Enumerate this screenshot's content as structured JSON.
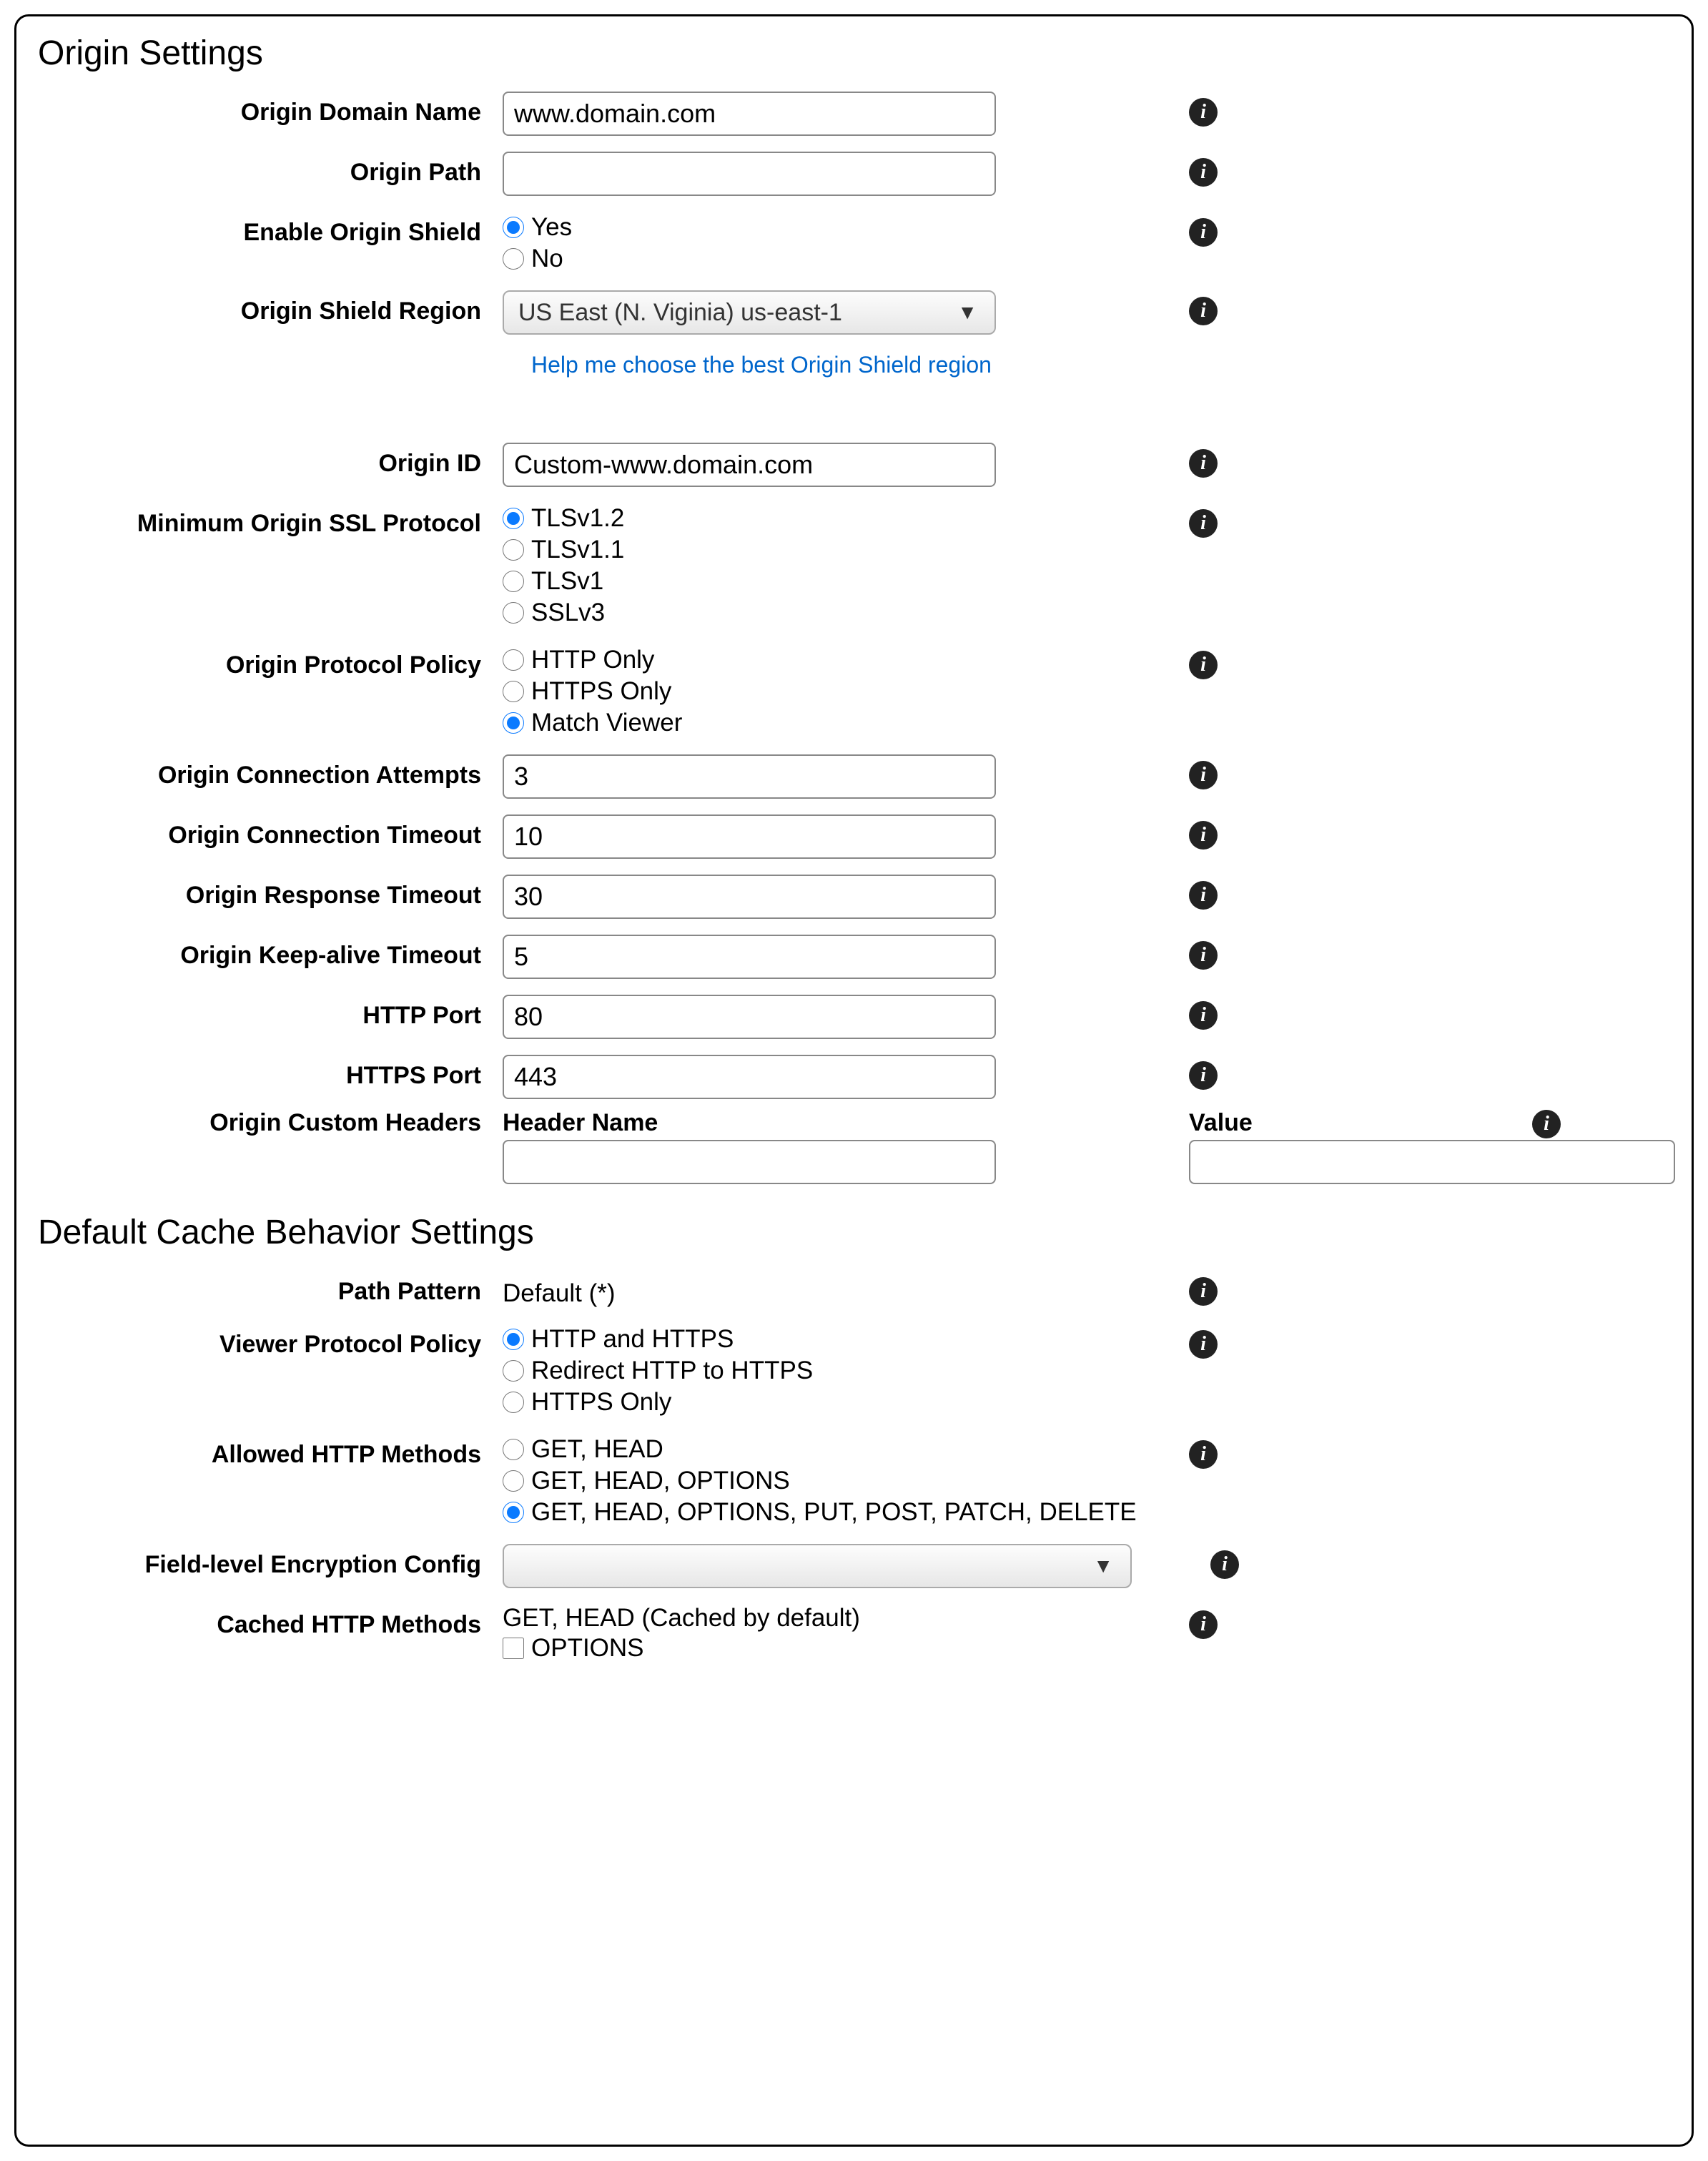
{
  "section1_title": "Origin Settings",
  "section2_title": "Default Cache Behavior Settings",
  "labels": {
    "origin_domain": "Origin Domain Name",
    "origin_path": "Origin Path",
    "enable_shield": "Enable Origin Shield",
    "shield_region": "Origin Shield Region",
    "origin_id": "Origin ID",
    "min_ssl": "Minimum Origin SSL Protocol",
    "protocol_policy": "Origin Protocol Policy",
    "conn_attempts": "Origin Connection Attempts",
    "conn_timeout": "Origin Connection Timeout",
    "resp_timeout": "Origin Response Timeout",
    "keepalive": "Origin Keep-alive Timeout",
    "http_port": "HTTP Port",
    "https_port": "HTTPS Port",
    "custom_headers": "Origin Custom Headers",
    "header_name": "Header Name",
    "header_value": "Value",
    "path_pattern": "Path Pattern",
    "viewer_policy": "Viewer Protocol Policy",
    "allowed_methods": "Allowed HTTP Methods",
    "fle_config": "Field-level Encryption Config",
    "cached_methods": "Cached HTTP Methods"
  },
  "values": {
    "origin_domain": "www.domain.com",
    "origin_path": "",
    "shield_yes": "Yes",
    "shield_no": "No",
    "shield_region": "US East (N. Viginia) us-east-1",
    "helper_link": "Help me choose the best Origin Shield region",
    "origin_id": "Custom-www.domain.com",
    "ssl_opts": [
      "TLSv1.2",
      "TLSv1.1",
      "TLSv1",
      "SSLv3"
    ],
    "proto_opts": [
      "HTTP Only",
      "HTTPS Only",
      "Match Viewer"
    ],
    "conn_attempts": "3",
    "conn_timeout": "10",
    "resp_timeout": "30",
    "keepalive": "5",
    "http_port": "80",
    "https_port": "443",
    "header_name": "",
    "header_value": "",
    "path_pattern": "Default (*)",
    "viewer_opts": [
      "HTTP and HTTPS",
      "Redirect HTTP to HTTPS",
      "HTTPS Only"
    ],
    "method_opts": [
      "GET, HEAD",
      "GET, HEAD, OPTIONS",
      "GET, HEAD, OPTIONS, PUT, POST, PATCH, DELETE"
    ],
    "fle_config": "",
    "cached_default": "GET, HEAD (Cached by default)",
    "cached_options": "OPTIONS"
  }
}
